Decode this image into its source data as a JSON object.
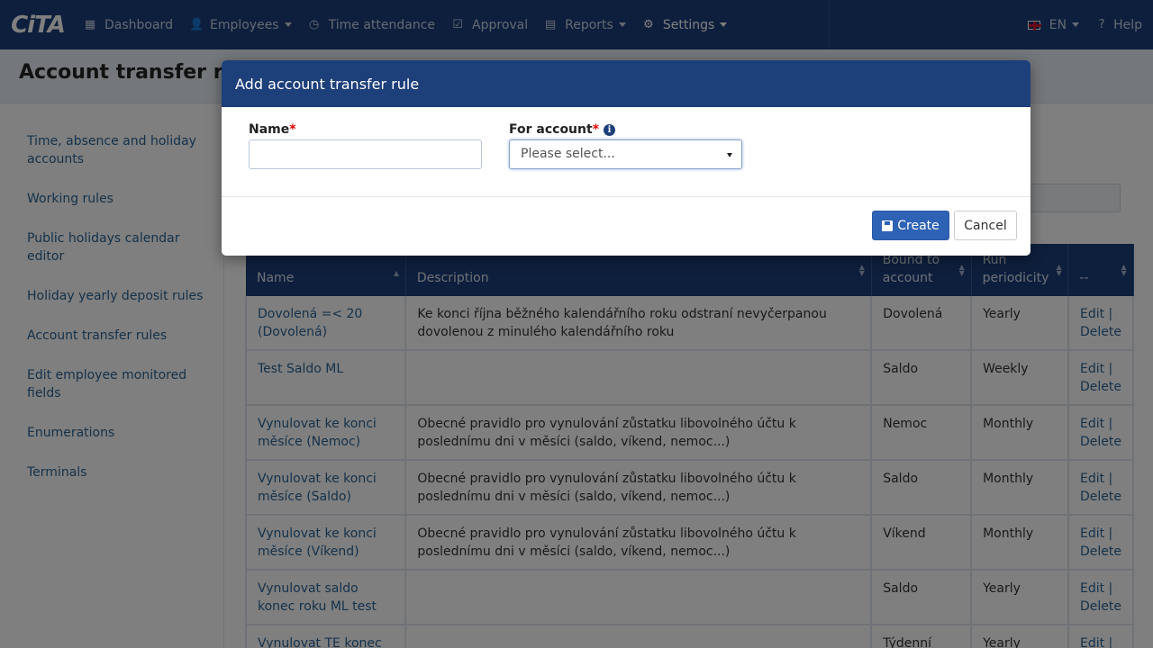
{
  "nav": {
    "logo": "CiTA",
    "items": [
      {
        "label": "Dashboard",
        "icon": "grid-icon"
      },
      {
        "label": "Employees",
        "icon": "user-icon",
        "dropdown": true
      },
      {
        "label": "Time attendance",
        "icon": "clock-icon"
      },
      {
        "label": "Approval",
        "icon": "check-icon"
      },
      {
        "label": "Reports",
        "icon": "print-icon",
        "dropdown": true
      },
      {
        "label": "Settings",
        "icon": "gear-icon",
        "dropdown": true,
        "active": true
      }
    ],
    "language": "EN",
    "help": "Help"
  },
  "page": {
    "title": "Account transfer rules"
  },
  "sidebar": {
    "items": [
      "Time, absence and holiday accounts",
      "Working rules",
      "Public holidays calendar editor",
      "Holiday yearly deposit rules",
      "Account transfer rules",
      "Edit employee monitored fields",
      "Enumerations",
      "Terminals"
    ]
  },
  "table": {
    "headers": [
      "Name",
      "Description",
      "Bound to account",
      "Run periodicity",
      "--"
    ],
    "rows": [
      {
        "name": "Dovolená =< 20 (Dovolená)",
        "description": "Ke konci října běžného kalendářního roku odstraní nevyčerpanou dovolenou z minulého kalendářního roku",
        "account": "Dovolená",
        "periodicity": "Yearly",
        "edit": "Edit |",
        "delete": "Delete"
      },
      {
        "name": "Test Saldo ML",
        "description": "",
        "account": "Saldo",
        "periodicity": "Weekly",
        "edit": "Edit |",
        "delete": "Delete"
      },
      {
        "name": "Vynulovat ke konci měsíce (Nemoc)",
        "description": "Obecné pravidlo pro vynulování zůstatku libovolného účtu k poslednímu dni v měsíci (saldo, víkend, nemoc...)",
        "account": "Nemoc",
        "periodicity": "Monthly",
        "edit": "Edit |",
        "delete": "Delete"
      },
      {
        "name": "Vynulovat ke konci měsíce (Saldo)",
        "description": "Obecné pravidlo pro vynulování zůstatku libovolného účtu k poslednímu dni v měsíci (saldo, víkend, nemoc...)",
        "account": "Saldo",
        "periodicity": "Monthly",
        "edit": "Edit |",
        "delete": "Delete"
      },
      {
        "name": "Vynulovat ke konci měsíce (Víkend)",
        "description": "Obecné pravidlo pro vynulování zůstatku libovolného účtu k poslednímu dni v měsíci (saldo, víkend, nemoc...)",
        "account": "Víkend",
        "periodicity": "Monthly",
        "edit": "Edit |",
        "delete": "Delete"
      },
      {
        "name": "Vynulovat saldo konec roku ML test",
        "description": "",
        "account": "Saldo",
        "periodicity": "Yearly",
        "edit": "Edit |",
        "delete": "Delete"
      },
      {
        "name": "Vynulovat TE konec",
        "description": "",
        "account": "Týdenní",
        "periodicity": "Yearly",
        "edit": "Edit |",
        "delete": ""
      }
    ]
  },
  "modal": {
    "title": "Add account transfer rule",
    "name_label": "Name",
    "account_label": "For account",
    "required_mark": "*",
    "name_value": "",
    "account_placeholder": "Please select...",
    "create_label": "Create",
    "cancel_label": "Cancel"
  },
  "colors": {
    "navbar": "#1d3f7a",
    "primary_button": "#2e62b5",
    "link": "#2a6496",
    "required": "#dd0000"
  }
}
